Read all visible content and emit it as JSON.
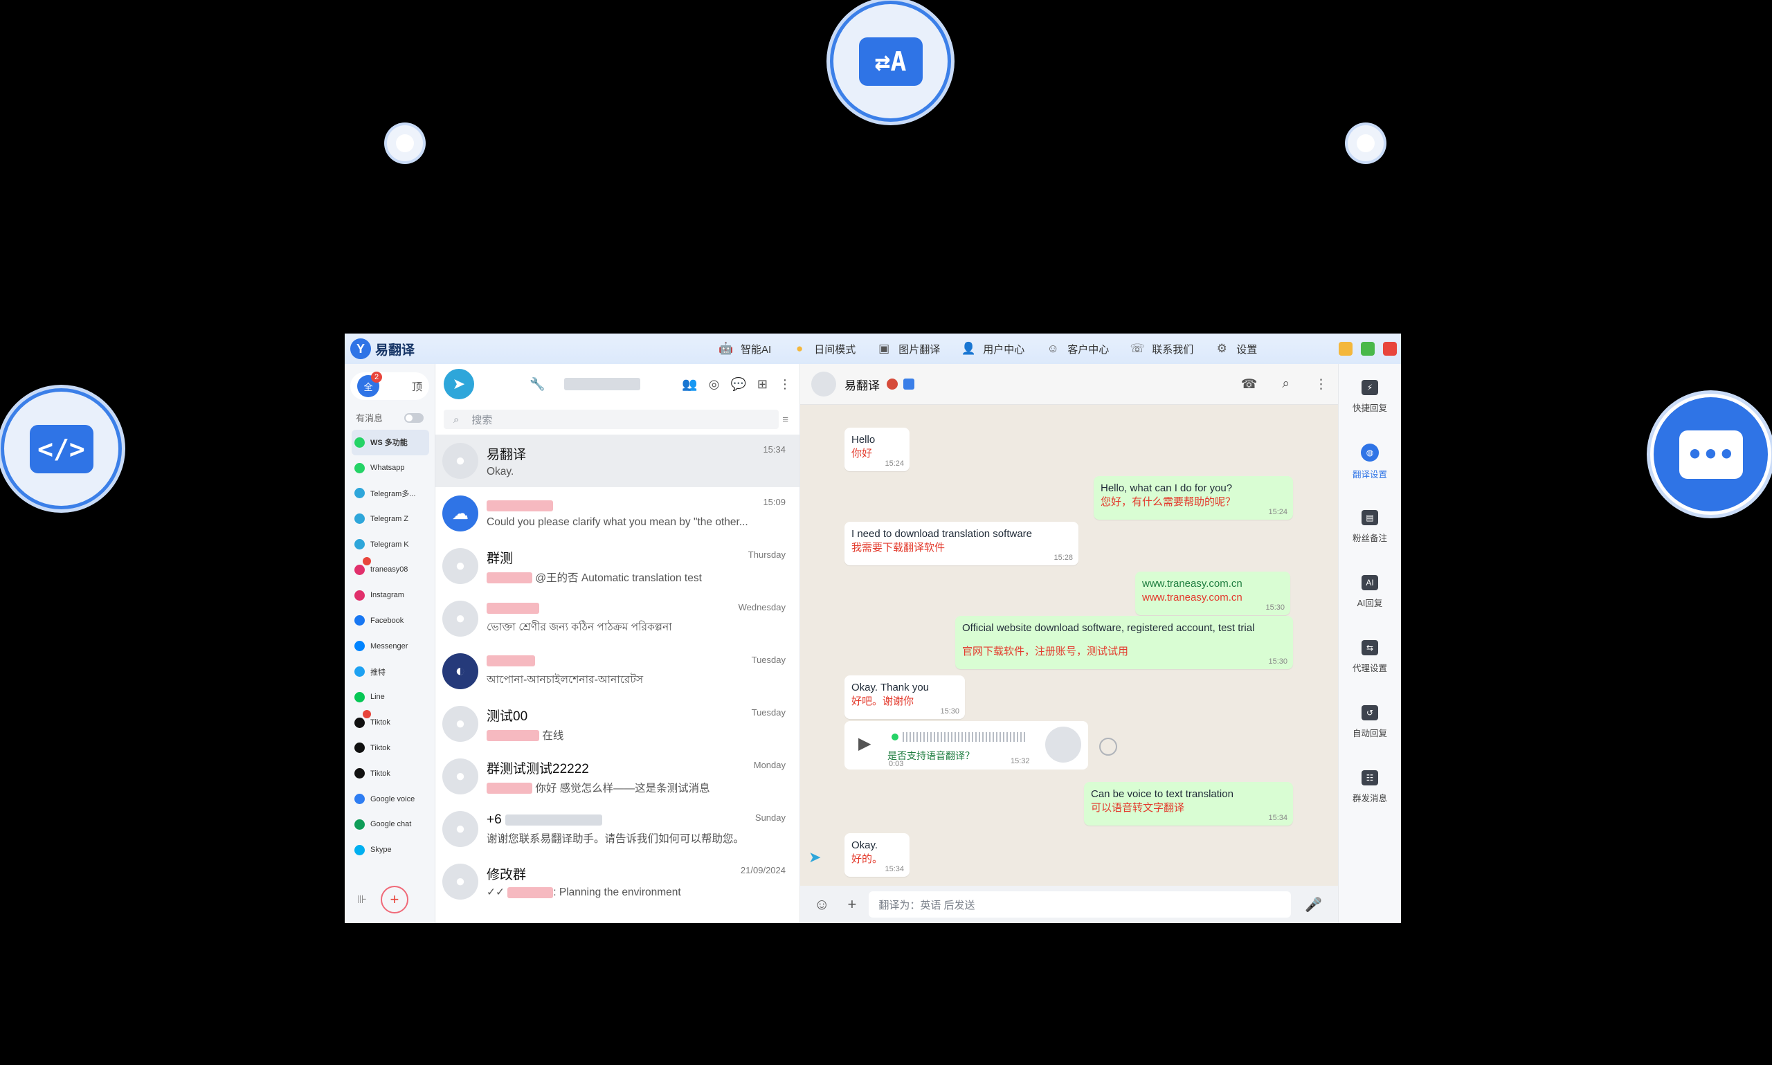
{
  "app": {
    "title": "易翻译",
    "logo_letter": "Y"
  },
  "top_menu": [
    {
      "label": "智能AI",
      "icon": "robot-icon"
    },
    {
      "label": "日间模式",
      "icon": "sun-icon"
    },
    {
      "label": "图片翻译",
      "icon": "image-translate-icon"
    },
    {
      "label": "用户中心",
      "icon": "user-icon"
    },
    {
      "label": "客户中心",
      "icon": "customer-icon"
    },
    {
      "label": "联系我们",
      "icon": "phone-icon"
    },
    {
      "label": "设置",
      "icon": "gear-icon"
    }
  ],
  "window_controls": {
    "minimize": "#f4b73b",
    "maximize": "#49b84a",
    "close": "#e8453c"
  },
  "sidebar": {
    "top_left_label": "全",
    "top_left_badge": "2",
    "top_right_label": "顶",
    "msg_toggle_label": "有消息",
    "platforms": [
      {
        "label": "WS 多功能",
        "color": "#25d366",
        "active": true
      },
      {
        "label": "Whatsapp",
        "color": "#25d366"
      },
      {
        "label": "Telegram多...",
        "color": "#2ea6da"
      },
      {
        "label": "Telegram Z",
        "color": "#2ea6da"
      },
      {
        "label": "Telegram K",
        "color": "#2ea6da"
      },
      {
        "label": "traneasy08",
        "color": "#e1306c",
        "badge": true
      },
      {
        "label": "Instagram",
        "color": "#e1306c"
      },
      {
        "label": "Facebook",
        "color": "#1877f2"
      },
      {
        "label": "Messenger",
        "color": "#0084ff"
      },
      {
        "label": "推特",
        "color": "#1da1f2"
      },
      {
        "label": "Line",
        "color": "#06c755"
      },
      {
        "label": "Tiktok",
        "color": "#111111",
        "badge": true
      },
      {
        "label": "Tiktok",
        "color": "#111111"
      },
      {
        "label": "Tiktok",
        "color": "#111111"
      },
      {
        "label": "Google voice",
        "color": "#2e7df2"
      },
      {
        "label": "Google chat",
        "color": "#0f9d58"
      },
      {
        "label": "Skype",
        "color": "#00aff0"
      }
    ]
  },
  "chat_list": {
    "search_placeholder": "搜索",
    "chats": [
      {
        "name": "易翻译",
        "preview": "Okay.",
        "time": "15:34",
        "selected": true
      },
      {
        "name": "",
        "preview": "Could you please clarify what you mean by \"the other...",
        "time": "15:09",
        "redacted_name": true
      },
      {
        "name": "群测",
        "preview": "@王的否 Automatic translation test",
        "time": "Thursday",
        "redacted_prefix": true
      },
      {
        "name": "",
        "preview": "ভোক্তা শ্রেণীর জন্য কঠিন পাঠক্রম পরিকল্পনা",
        "time": "Wednesday",
        "redacted_name": true
      },
      {
        "name": "",
        "preview": "আপোনা-আনচাইলশেনার-আনারেটস",
        "time": "Tuesday",
        "redacted_name": true
      },
      {
        "name": "测试00",
        "preview": "在线",
        "time": "Tuesday",
        "redacted_prefix": true
      },
      {
        "name": "群测试测试22222",
        "preview": "你好  感觉怎么样——这是条测试消息",
        "time": "Monday",
        "redacted_prefix": true
      },
      {
        "name": "+6",
        "preview": "谢谢您联系易翻译助手。请告诉我们如何可以帮助您。",
        "time": "Sunday"
      },
      {
        "name": "修改群",
        "preview": ": Planning the environment",
        "time": "21/09/2024",
        "redacted_prefix": true
      }
    ]
  },
  "conversation": {
    "title": "易翻译",
    "composer_placeholder": "翻译为：英语 后发送",
    "messages": [
      {
        "dir": "in",
        "text": "Hello",
        "translation": "你好",
        "time": "15:24"
      },
      {
        "dir": "out",
        "text": "Hello, what can I do for you?",
        "translation": "您好，有什么需要帮助的呢？",
        "time": "15:24"
      },
      {
        "dir": "in",
        "text": "I need to download translation software",
        "translation": "我需要下载翻译软件",
        "time": "15:28"
      },
      {
        "dir": "out",
        "text": "www.traneasy.com.cn",
        "translation": "www.traneasy.com.cn",
        "time": "15:30"
      },
      {
        "dir": "out",
        "text": "Official website download software, registered account, test trial",
        "translation": "官网下载软件，注册账号，测试试用",
        "time": "15:30"
      },
      {
        "dir": "in",
        "text": "Okay. Thank you",
        "translation": "好吧。谢谢你",
        "time": "15:30"
      },
      {
        "dir": "out",
        "text": "Can be voice to text translation",
        "translation": "可以语音转文字翻译",
        "time": "15:34"
      },
      {
        "dir": "in",
        "text": "Okay.",
        "translation": "好的。",
        "time": "15:34"
      }
    ],
    "voice": {
      "duration": "0:03",
      "transcript": "是否支持语音翻译？",
      "time": "15:32"
    }
  },
  "right_panel": [
    {
      "label": "快捷回复"
    },
    {
      "label": "翻译设置",
      "active": true
    },
    {
      "label": "粉丝备注"
    },
    {
      "label": "AI回复"
    },
    {
      "label": "代理设置"
    },
    {
      "label": "自动回复"
    },
    {
      "label": "群发消息"
    }
  ]
}
